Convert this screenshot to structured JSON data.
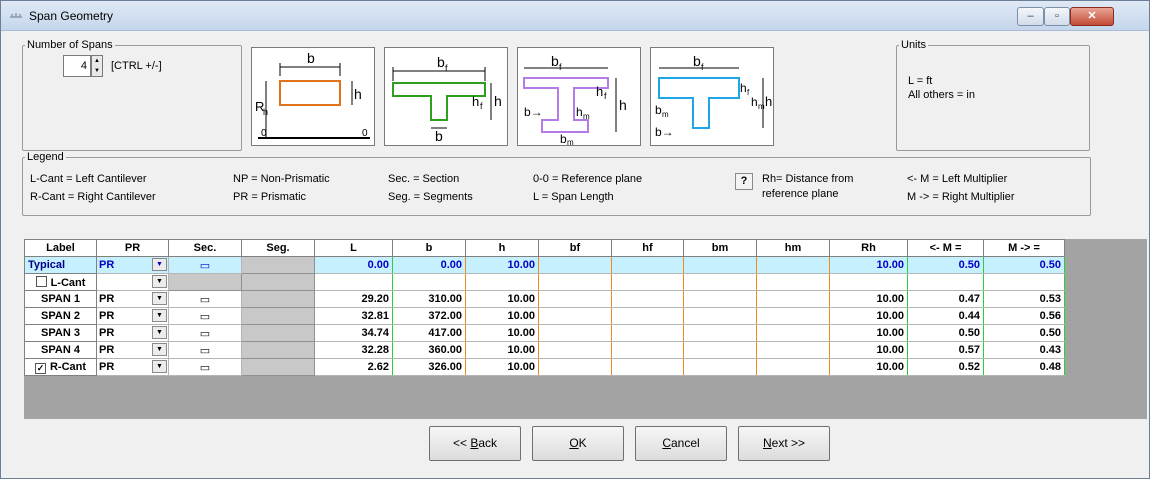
{
  "window": {
    "title": "Span Geometry",
    "min": "–",
    "max": "▫",
    "close": "✕"
  },
  "spans": {
    "legend": "Number of Spans",
    "value": "4",
    "hint": "[CTRL +/-]"
  },
  "units": {
    "legend": "Units",
    "line1": "L =  ft",
    "line2": "All others = in"
  },
  "diagrams": {
    "rect": {
      "b": "b",
      "h": "h",
      "rh": "R",
      "rh_sub": "h",
      "o1": "0",
      "o2": "0"
    },
    "tee": {
      "bf": "b",
      "bf_sub": "f",
      "hf": "h",
      "hf_sub": "f",
      "h": "h",
      "b": "b"
    },
    "ibeam": {
      "bf": "b",
      "bf_sub": "f",
      "hf": "h",
      "hf_sub": "f",
      "h": "h",
      "b": "b→",
      "hm": "h",
      "hm_sub": "m",
      "bm": "b",
      "bm_sub": "m"
    },
    "tee2": {
      "bf": "b",
      "bf_sub": "f",
      "hf": "h",
      "hf_sub": "f",
      "hm": "h",
      "hm_sub": "m",
      "h": "h",
      "bm": "b",
      "bm_sub": "m",
      "b": "b→"
    }
  },
  "legend": {
    "title": "Legend",
    "lcant": "L-Cant = Left Cantilever",
    "rcant": "R-Cant = Right Cantilever",
    "np": "NP = Non-Prismatic",
    "pr": "PR = Prismatic",
    "sec": "Sec. = Section",
    "seg": "Seg. = Segments",
    "oo": "0-0 = Reference plane",
    "l": "L =  Span Length",
    "help": "?",
    "rh1": "Rh= Distance from",
    "rh2": "reference plane",
    "lm": "<- M = Left Multiplier",
    "rm": "M -> = Right Multiplier"
  },
  "table": {
    "headers": [
      "Label",
      "PR",
      "Sec.",
      "Seg.",
      "L",
      "b",
      "h",
      "bf",
      "hf",
      "bm",
      "hm",
      "Rh",
      "<- M =",
      "M -> ="
    ],
    "rows": [
      {
        "label": "Typical",
        "pr": "PR",
        "sec": "▭",
        "L": "0.00",
        "b": "0.00",
        "h": "10.00",
        "bf": "",
        "hf": "",
        "bm": "",
        "hm": "",
        "rh": "10.00",
        "lm": "0.50",
        "rm": "0.50"
      },
      {
        "label": "L-Cant",
        "check": "",
        "pr": "",
        "sec": "",
        "L": "",
        "b": "",
        "h": "",
        "bf": "",
        "hf": "",
        "bm": "",
        "hm": "",
        "rh": "",
        "lm": "",
        "rm": ""
      },
      {
        "label": "SPAN 1",
        "pr": "PR",
        "sec": "▭",
        "L": "29.20",
        "b": "310.00",
        "h": "10.00",
        "bf": "",
        "hf": "",
        "bm": "",
        "hm": "",
        "rh": "10.00",
        "lm": "0.47",
        "rm": "0.53"
      },
      {
        "label": "SPAN 2",
        "pr": "PR",
        "sec": "▭",
        "L": "32.81",
        "b": "372.00",
        "h": "10.00",
        "bf": "",
        "hf": "",
        "bm": "",
        "hm": "",
        "rh": "10.00",
        "lm": "0.44",
        "rm": "0.56"
      },
      {
        "label": "SPAN 3",
        "pr": "PR",
        "sec": "▭",
        "L": "34.74",
        "b": "417.00",
        "h": "10.00",
        "bf": "",
        "hf": "",
        "bm": "",
        "hm": "",
        "rh": "10.00",
        "lm": "0.50",
        "rm": "0.50"
      },
      {
        "label": "SPAN 4",
        "pr": "PR",
        "sec": "▭",
        "L": "32.28",
        "b": "360.00",
        "h": "10.00",
        "bf": "",
        "hf": "",
        "bm": "",
        "hm": "",
        "rh": "10.00",
        "lm": "0.57",
        "rm": "0.43"
      },
      {
        "label": "R-Cant",
        "check": "✓",
        "pr": "PR",
        "sec": "▭",
        "L": "2.62",
        "b": "326.00",
        "h": "10.00",
        "bf": "",
        "hf": "",
        "bm": "",
        "hm": "",
        "rh": "10.00",
        "lm": "0.52",
        "rm": "0.48"
      }
    ]
  },
  "buttons": {
    "back_pre": "<< ",
    "back_key": "B",
    "back_post": "ack",
    "ok_key": "O",
    "ok_post": "K",
    "cancel_key": "C",
    "cancel_post": "ancel",
    "next_key": "N",
    "next_post": "ext >>"
  },
  "colors": {
    "typical_fill": "#c7f0ff",
    "green_border": "#2ecc40",
    "orange_border": "#ee8a1e",
    "purple_shape": "#b57be8",
    "blue_shape": "#1ea7e8"
  }
}
